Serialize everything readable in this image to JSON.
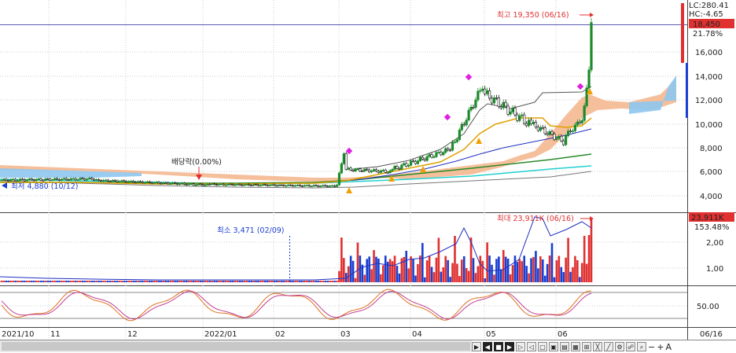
{
  "price_panel": {
    "high_annotation": "최고 19,350 (06/16)",
    "low_annotation": "최저 4,880 (10/12)",
    "dividend_label": "배당락(0.00%)",
    "lc_label": "LC:280.41",
    "hc_label": "HC:-4.65",
    "price_box": "18,450",
    "pct_label": "21.78%",
    "y_ticks": [
      "16,000",
      "14,000",
      "12,000",
      "10,000",
      "8,000",
      "6,000",
      "4,000"
    ]
  },
  "volume_panel": {
    "max_annotation": "최대 23,911K (06/16)",
    "min_annotation": "최소 3,471 (02/09)",
    "value_box": "23,911K",
    "pct_label": "153.48%",
    "y_ticks": [
      "2,00",
      "1,00"
    ]
  },
  "stoch_panel": {
    "y_tick": "50.00"
  },
  "x_axis": {
    "labels": [
      "2021/10",
      "11",
      "12",
      "2022/01",
      "02",
      "03",
      "04",
      "05",
      "06"
    ],
    "right_label": "06/16"
  },
  "colors": {
    "up": "#e03030",
    "down": "#1a3fd0",
    "green_candle": "#1b8a2a",
    "ma_green": "#2a8a2a",
    "ma_cyan": "#22d0d0",
    "ma_gray": "#777777",
    "ma_blue": "#2030c0",
    "ma_orange": "#e0a000",
    "cloud": "#f4b48a",
    "cloud_blue": "#8ec6ee",
    "magenta": "#e020e0"
  },
  "chart_data": {
    "type": "line",
    "title": "",
    "series": [
      {
        "name": "",
        "x": [
          "2021/10",
          "11",
          "12",
          "2022/01",
          "02",
          "03",
          "04",
          "05",
          "06"
        ],
        "values": [
          5200,
          5300,
          5000,
          4800,
          4800,
          5300,
          7400,
          11000,
          18450
        ]
      }
    ],
    "ylim": [
      4000,
      19350
    ],
    "high": 19350,
    "low": 4880
  },
  "toolbar": {
    "zoom_out": "−",
    "zoom_in": "+",
    "font": "A"
  }
}
